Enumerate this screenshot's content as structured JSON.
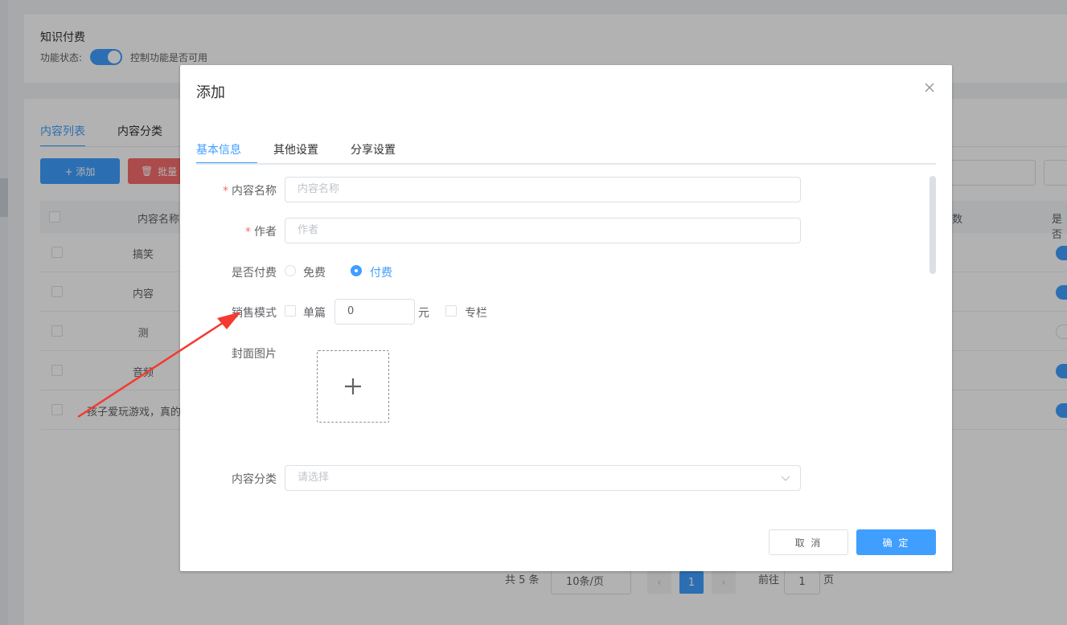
{
  "background": {
    "section_title": "知识付费",
    "status_label": "功能状态:",
    "status_desc": "控制功能是否可用",
    "tabs": [
      "内容列表",
      "内容分类"
    ],
    "add_button": "+ 添加",
    "delete_button": "批量",
    "table": {
      "col_name": "内容名称",
      "col_count": "数",
      "col_switch": "是否",
      "rows": [
        "搞笑",
        "内容",
        "测",
        "音频",
        "孩子爱玩游戏，真的"
      ]
    },
    "pager": {
      "total": "共 5 条",
      "page_size": "10条/页",
      "current": "1",
      "goto_label": "前往",
      "goto_value": "1",
      "page_unit": "页"
    }
  },
  "dialog": {
    "title": "添加",
    "tabs": [
      {
        "label": "基本信息",
        "active": true
      },
      {
        "label": "其他设置",
        "active": false
      },
      {
        "label": "分享设置",
        "active": false
      }
    ],
    "form": {
      "content_name": {
        "label": "内容名称",
        "placeholder": "内容名称",
        "required": true
      },
      "author": {
        "label": "作者",
        "placeholder": "作者",
        "required": true
      },
      "paid": {
        "label": "是否付费",
        "options": [
          "免费",
          "付费"
        ],
        "selected": "付费"
      },
      "sale_mode": {
        "label": "销售模式",
        "single_label": "单篇",
        "price_value": "0",
        "unit": "元",
        "column_label": "专栏"
      },
      "cover": {
        "label": "封面图片"
      },
      "category": {
        "label": "内容分类",
        "placeholder": "请选择"
      }
    },
    "cancel_button": "取 消",
    "ok_button": "确 定"
  },
  "colors": {
    "primary": "#409eff",
    "danger": "#f56c6c",
    "annotation": "#f53a2f"
  }
}
